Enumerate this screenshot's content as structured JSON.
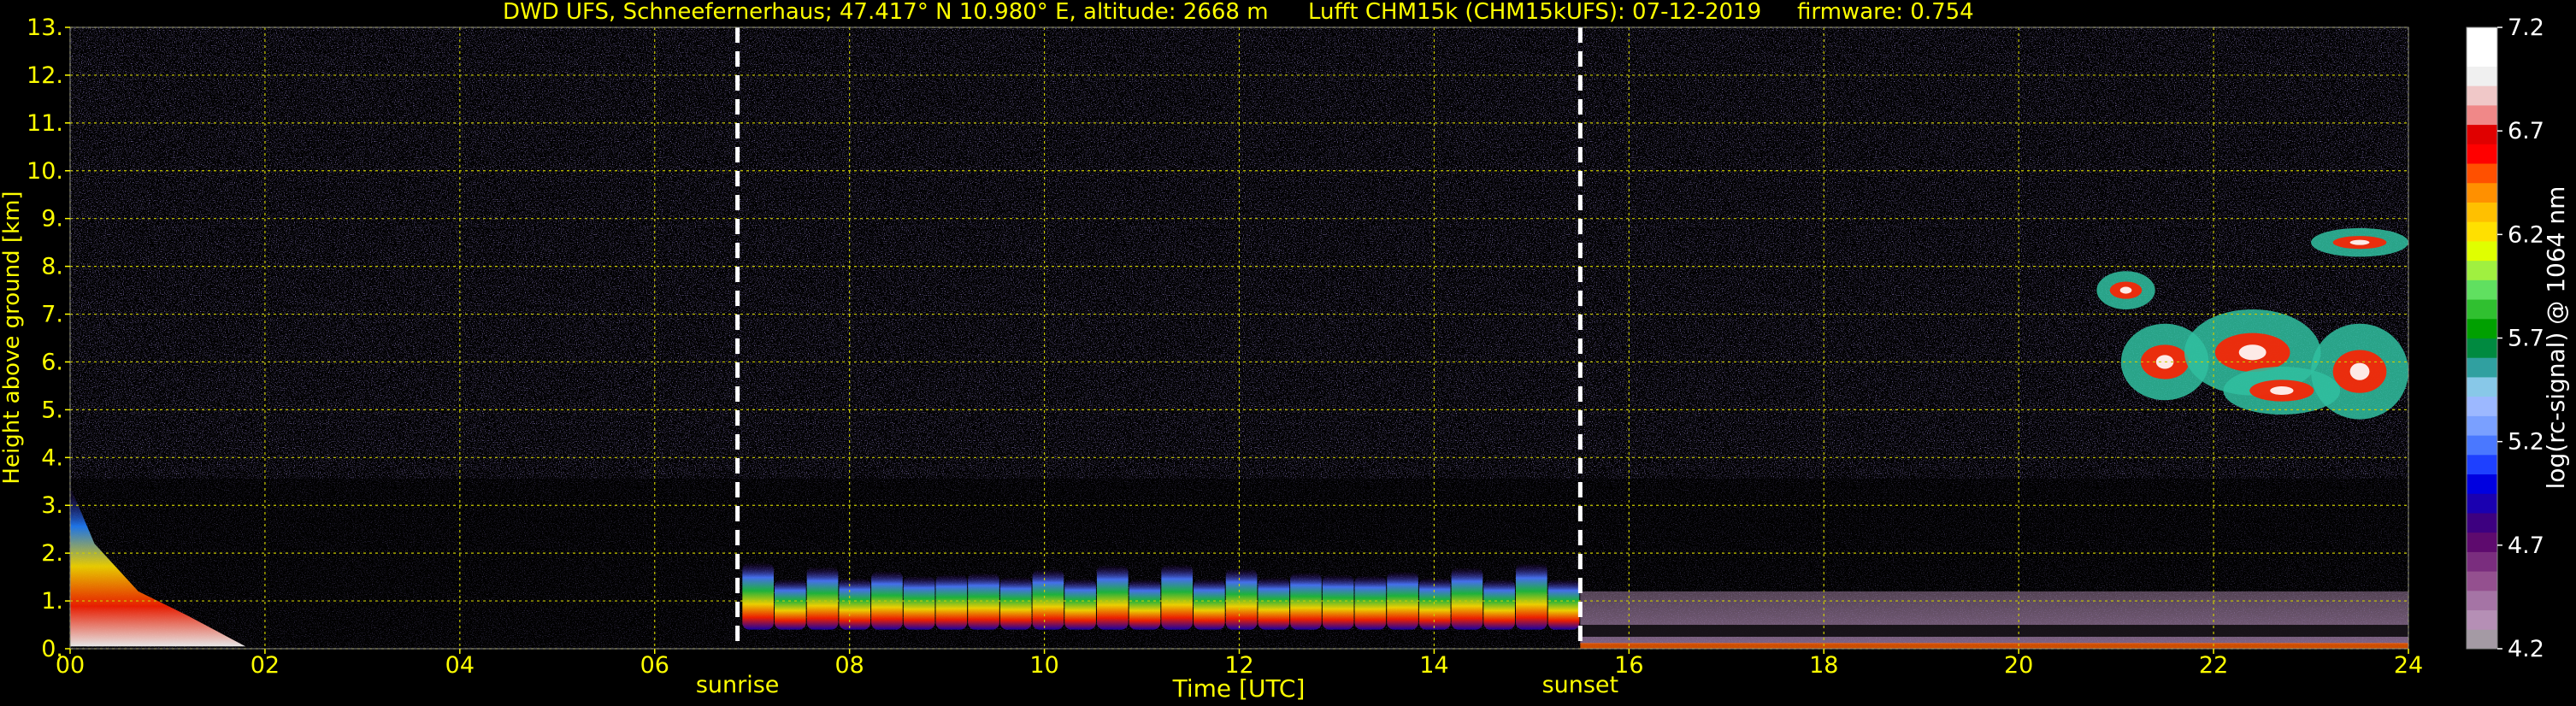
{
  "chart_data": {
    "type": "heatmap",
    "title_site": "DWD UFS, Schneefernerhaus; 47.417° N 10.980° E, altitude: 2668 m",
    "title_instrument": "Lufft CHM15k (CHM15kUFS): 07-12-2019",
    "title_firmware": "firmware: 0.754",
    "xlabel": "Time [UTC]",
    "ylabel": "Height above ground [km]",
    "xlim": [
      0,
      24
    ],
    "ylim": [
      0,
      13
    ],
    "x_ticks": [
      "00",
      "02",
      "04",
      "06",
      "08",
      "10",
      "12",
      "14",
      "16",
      "18",
      "20",
      "22",
      "24"
    ],
    "y_ticks": [
      "0.",
      "1.",
      "2.",
      "3.",
      "4.",
      "5.",
      "6.",
      "7.",
      "8.",
      "9.",
      "10.",
      "11.",
      "12.",
      "13."
    ],
    "grid": true,
    "events": [
      {
        "label": "sunrise",
        "time_utc": 6.85
      },
      {
        "label": "sunset",
        "time_utc": 15.5
      }
    ],
    "colorbar": {
      "label": "log(rc-signal) @ 1064 nm",
      "min": 4.2,
      "max": 7.2,
      "ticks": [
        "7.2",
        "6.7",
        "6.2",
        "5.7",
        "5.2",
        "4.7",
        "4.2"
      ],
      "colors": [
        "#a49aa4",
        "#b58fb5",
        "#a574a5",
        "#94508f",
        "#7a2d7e",
        "#5e0a6e",
        "#3d0080",
        "#1a00b0",
        "#0000e0",
        "#1e40ff",
        "#4a78ff",
        "#7aa0ff",
        "#9cb8ff",
        "#88c8e8",
        "#30a0a0",
        "#008a40",
        "#00a000",
        "#30c030",
        "#60e060",
        "#a0f040",
        "#e0ff00",
        "#ffe000",
        "#ffc000",
        "#ff9000",
        "#ff5000",
        "#ff0000",
        "#e00000",
        "#f08888",
        "#f0c8c8",
        "#f0f0f0",
        "#ffffff",
        "#ffffff"
      ]
    },
    "features": [
      {
        "name": "morning low aerosol layer",
        "t_start": 0.0,
        "t_end": 1.8,
        "z_base": 0.05,
        "z_top": 3.4
      },
      {
        "name": "daytime boundary layer",
        "t_start": 6.9,
        "t_end": 15.5,
        "z_base": 0.4,
        "z_top": 1.8
      },
      {
        "name": "evening residual layer",
        "t_start": 15.5,
        "t_end": 24.0,
        "z_base": 0.1,
        "z_top": 1.2
      },
      {
        "name": "upper cloud layer",
        "t_start": 20.9,
        "t_end": 24.0,
        "z_base": 4.5,
        "z_top": 8.8
      }
    ]
  }
}
